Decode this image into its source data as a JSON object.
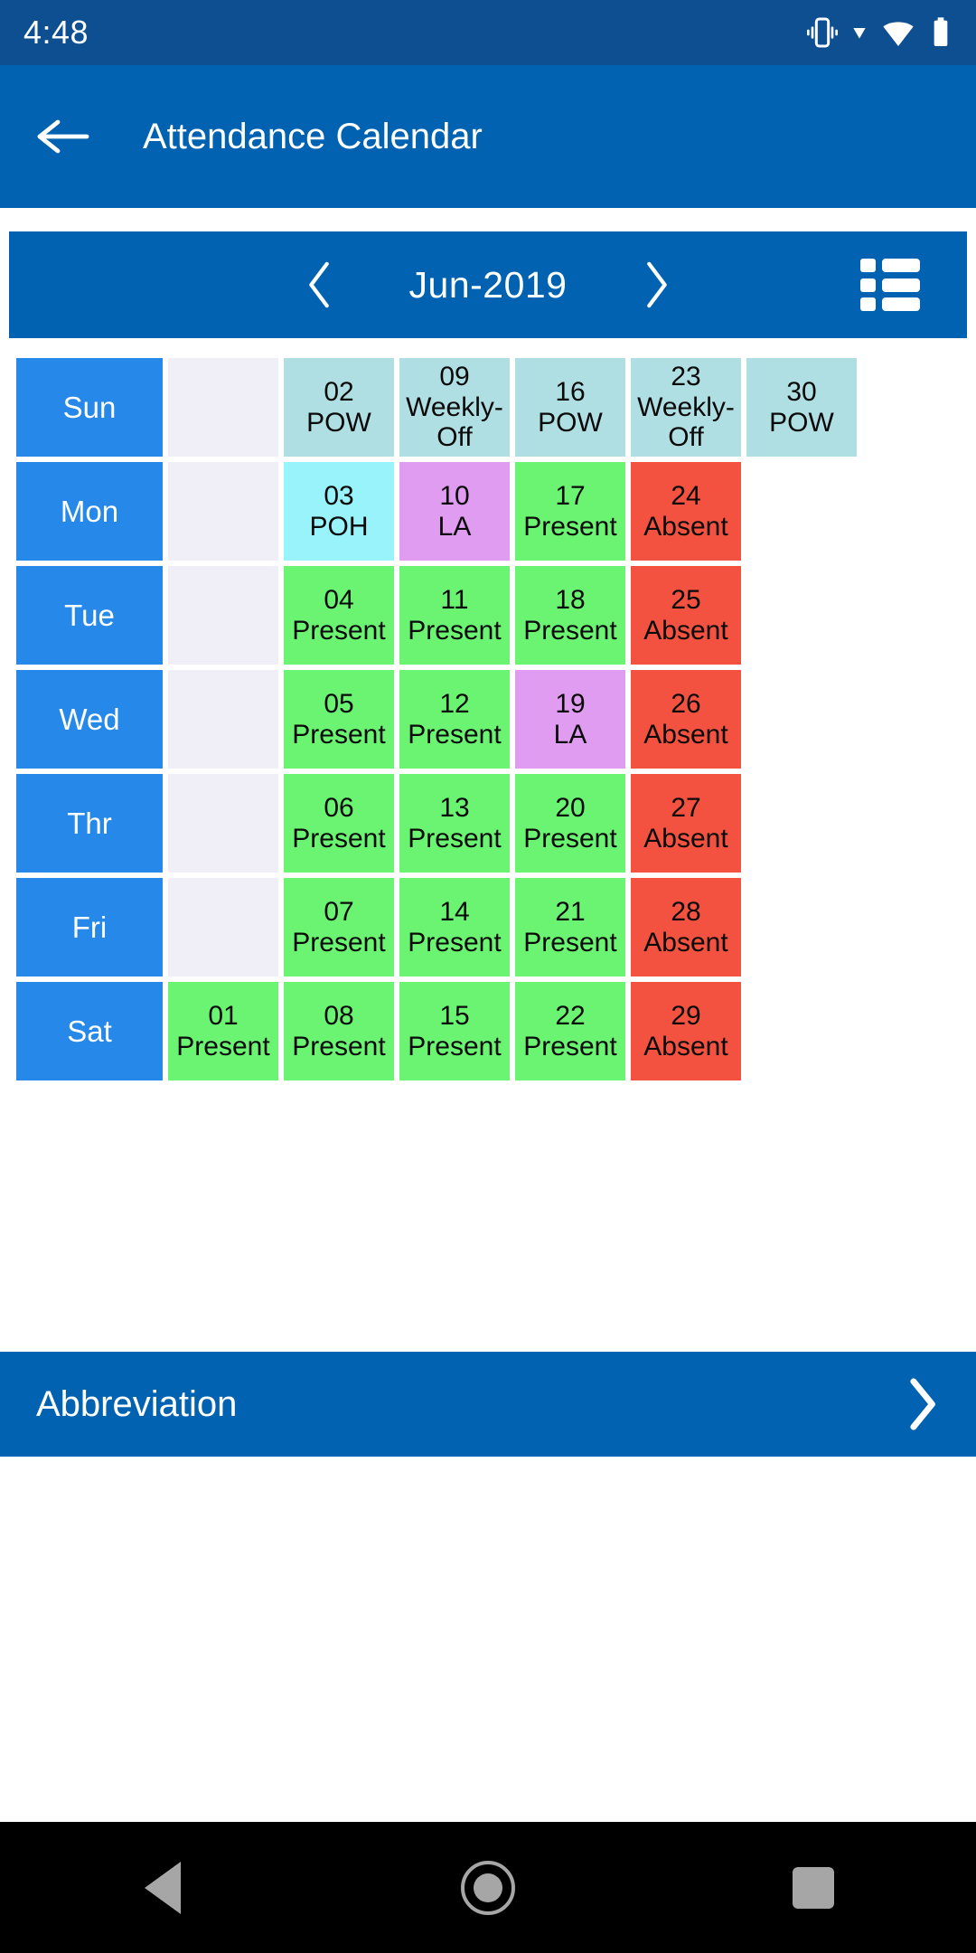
{
  "status_bar": {
    "time": "4:48",
    "icons": [
      "vibrate-icon",
      "dropdown-triangle-icon",
      "wifi-icon",
      "battery-icon"
    ]
  },
  "app_bar": {
    "back_icon": "back-arrow-icon",
    "title": "Attendance Calendar"
  },
  "month_nav": {
    "prev_icon": "chevron-left-icon",
    "month_label": "Jun-2019",
    "next_icon": "chevron-right-icon",
    "list_view_icon": "list-view-icon"
  },
  "calendar": {
    "day_labels": [
      "Sun",
      "Mon",
      "Tue",
      "Wed",
      "Thr",
      "Fri",
      "Sat"
    ],
    "rows": [
      {
        "day": "Sun",
        "cells": [
          {
            "num": "",
            "status": "",
            "type": "empty"
          },
          {
            "num": "02",
            "status": "POW",
            "type": "pow"
          },
          {
            "num": "09",
            "status": "Weekly-Off",
            "type": "pow"
          },
          {
            "num": "16",
            "status": "POW",
            "type": "pow"
          },
          {
            "num": "23",
            "status": "Weekly-Off",
            "type": "pow"
          },
          {
            "num": "30",
            "status": "POW",
            "type": "pow"
          }
        ]
      },
      {
        "day": "Mon",
        "cells": [
          {
            "num": "",
            "status": "",
            "type": "empty"
          },
          {
            "num": "03",
            "status": "POH",
            "type": "poh"
          },
          {
            "num": "10",
            "status": "LA",
            "type": "la"
          },
          {
            "num": "17",
            "status": "Present",
            "type": "present"
          },
          {
            "num": "24",
            "status": "Absent",
            "type": "absent"
          },
          {
            "num": "",
            "status": "",
            "type": "blank"
          }
        ]
      },
      {
        "day": "Tue",
        "cells": [
          {
            "num": "",
            "status": "",
            "type": "empty"
          },
          {
            "num": "04",
            "status": "Present",
            "type": "present"
          },
          {
            "num": "11",
            "status": "Present",
            "type": "present"
          },
          {
            "num": "18",
            "status": "Present",
            "type": "present"
          },
          {
            "num": "25",
            "status": "Absent",
            "type": "absent"
          },
          {
            "num": "",
            "status": "",
            "type": "blank"
          }
        ]
      },
      {
        "day": "Wed",
        "cells": [
          {
            "num": "",
            "status": "",
            "type": "empty"
          },
          {
            "num": "05",
            "status": "Present",
            "type": "present"
          },
          {
            "num": "12",
            "status": "Present",
            "type": "present"
          },
          {
            "num": "19",
            "status": "LA",
            "type": "la"
          },
          {
            "num": "26",
            "status": "Absent",
            "type": "absent"
          },
          {
            "num": "",
            "status": "",
            "type": "blank"
          }
        ]
      },
      {
        "day": "Thr",
        "cells": [
          {
            "num": "",
            "status": "",
            "type": "empty"
          },
          {
            "num": "06",
            "status": "Present",
            "type": "present"
          },
          {
            "num": "13",
            "status": "Present",
            "type": "present"
          },
          {
            "num": "20",
            "status": "Present",
            "type": "present"
          },
          {
            "num": "27",
            "status": "Absent",
            "type": "absent"
          },
          {
            "num": "",
            "status": "",
            "type": "blank"
          }
        ]
      },
      {
        "day": "Fri",
        "cells": [
          {
            "num": "",
            "status": "",
            "type": "empty"
          },
          {
            "num": "07",
            "status": "Present",
            "type": "present"
          },
          {
            "num": "14",
            "status": "Present",
            "type": "present"
          },
          {
            "num": "21",
            "status": "Present",
            "type": "present"
          },
          {
            "num": "28",
            "status": "Absent",
            "type": "absent"
          },
          {
            "num": "",
            "status": "",
            "type": "blank"
          }
        ]
      },
      {
        "day": "Sat",
        "cells": [
          {
            "num": "01",
            "status": "Present",
            "type": "present"
          },
          {
            "num": "08",
            "status": "Present",
            "type": "present"
          },
          {
            "num": "15",
            "status": "Present",
            "type": "present"
          },
          {
            "num": "22",
            "status": "Present",
            "type": "present"
          },
          {
            "num": "29",
            "status": "Absent",
            "type": "absent"
          },
          {
            "num": "",
            "status": "",
            "type": "blank"
          }
        ]
      }
    ]
  },
  "abbreviation": {
    "label": "Abbreviation",
    "chevron_icon": "chevron-right-icon"
  },
  "nav_bar": {
    "back": "back-triangle-icon",
    "home": "home-circle-icon",
    "recents": "recents-square-icon"
  },
  "colors": {
    "status_bar": "#0d4f91",
    "app_bar": "#0062b1",
    "day_label": "#2689ea",
    "present": "#6bf472",
    "absent": "#f2523f",
    "weekly_off": "#b0dfe3",
    "holiday": "#99f3fb",
    "leave": "#e09cf0",
    "empty": "#f0eef7"
  }
}
